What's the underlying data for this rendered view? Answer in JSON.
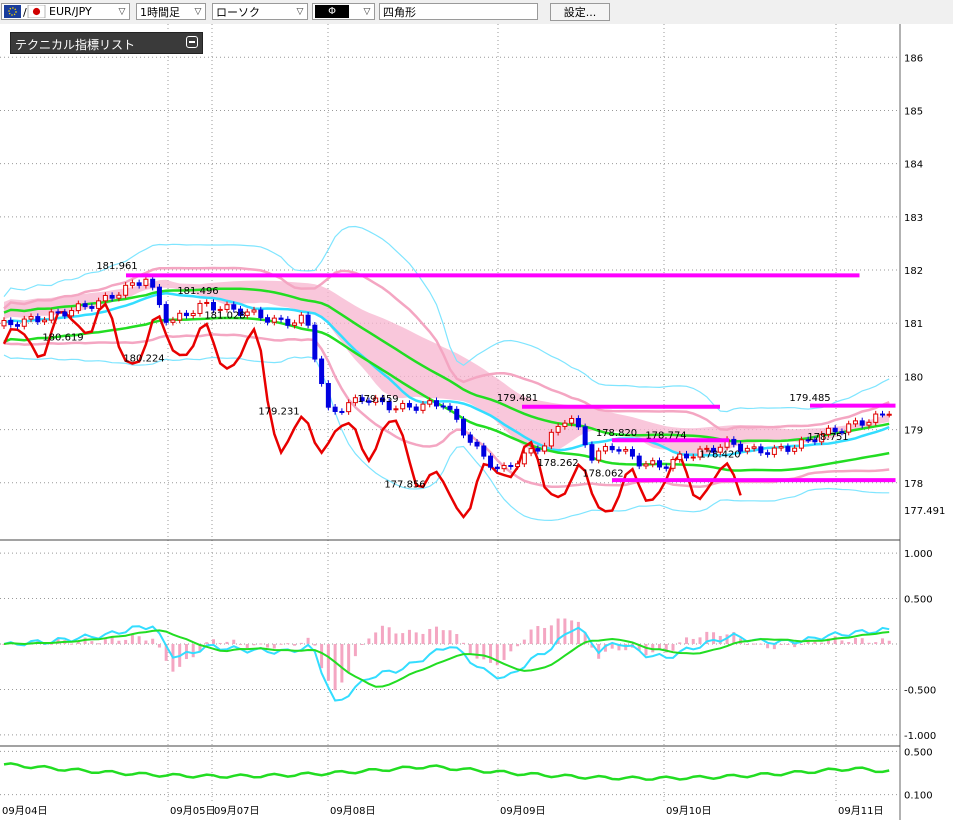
{
  "toolbar": {
    "symbol": "EUR/JPY",
    "timeframe": "1時間足",
    "chart_style": "ローソク",
    "drawing_mode": "Φ",
    "drawing_object": "四角形",
    "settings_button": "設定..."
  },
  "indicator_list": {
    "label": "テクニカル指標リスト"
  },
  "colors": {
    "bull_candle": "#e00000",
    "bear_candle": "#0000e0",
    "cloud": "#f7b4cf",
    "bollinger_inner": "#f4a6c2",
    "bollinger_outer": "#7fe5ff",
    "moving_average": "#22dd22",
    "base_line": "#33ddff",
    "lagging_span": "#e80000",
    "drawn_line": "#ff00ff",
    "histogram": "#f4a6c2"
  },
  "chart_data": [
    {
      "type": "candlestick",
      "x_axis": [
        "09月04日",
        "09月05日",
        "09月07日",
        "09月08日",
        "09月09日",
        "09月10日",
        "09月11日"
      ],
      "y_axis_ticks": [
        "186",
        "185",
        "184",
        "183",
        "182",
        "181",
        "180",
        "179",
        "178"
      ],
      "current_price": "177.491",
      "ylim": [
        177.3,
        186.4
      ],
      "annotations": [
        {
          "text": "181.961",
          "price": 181.961
        },
        {
          "text": "181.496",
          "price": 181.496
        },
        {
          "text": "181.028",
          "price": 181.028
        },
        {
          "text": "180.619",
          "price": 180.619
        },
        {
          "text": "180.224",
          "price": 180.224
        },
        {
          "text": "179.459",
          "price": 179.459
        },
        {
          "text": "179.231",
          "price": 179.231
        },
        {
          "text": "179.481",
          "price": 179.481
        },
        {
          "text": "177.856",
          "price": 177.856
        },
        {
          "text": "178.820",
          "price": 178.82
        },
        {
          "text": "178.774",
          "price": 178.774
        },
        {
          "text": "178.262",
          "price": 178.262
        },
        {
          "text": "178.062",
          "price": 178.062
        },
        {
          "text": "178.420",
          "price": 178.42
        },
        {
          "text": "179.485",
          "price": 179.485
        },
        {
          "text": "178.751",
          "price": 178.751
        }
      ],
      "horizontal_lines": [
        181.9,
        179.43,
        178.8,
        178.05,
        179.45
      ]
    },
    {
      "type": "line",
      "name": "oscillator",
      "y_axis_ticks": [
        "1.000",
        "0.500",
        "-0.500",
        "-1.000"
      ],
      "ylim": [
        -1.1,
        1.1
      ]
    },
    {
      "type": "line",
      "name": "lower",
      "y_axis_ticks": [
        "0.500",
        "0.100"
      ],
      "ylim": [
        0.05,
        0.55
      ]
    }
  ]
}
